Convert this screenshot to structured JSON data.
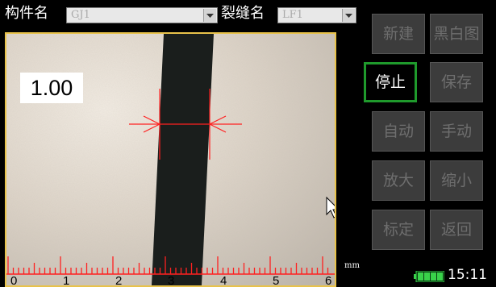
{
  "header": {
    "component_label": "构件名",
    "component_value": "GJ1",
    "crack_label": "裂缝名",
    "crack_value": "LF1"
  },
  "viewer": {
    "measurement_value": "1.00",
    "scale_ticks": [
      "0",
      "1",
      "2",
      "3",
      "4",
      "5",
      "6"
    ],
    "unit": "mm"
  },
  "buttons": [
    {
      "label": "新建",
      "active": false
    },
    {
      "label": "黑白图",
      "active": false
    },
    {
      "label": "停止",
      "active": true
    },
    {
      "label": "保存",
      "active": false
    },
    {
      "label": "自动",
      "active": false
    },
    {
      "label": "手动",
      "active": false
    },
    {
      "label": "放大",
      "active": false
    },
    {
      "label": "缩小",
      "active": false
    },
    {
      "label": "标定",
      "active": false
    },
    {
      "label": "返回",
      "active": false
    }
  ],
  "status": {
    "time": "15:11",
    "battery_level": 1.0
  },
  "colors": {
    "measure_line": "#ff2020",
    "viewport_border": "#e8c24a",
    "active_button_border": "#1f9a2c",
    "battery": "#39d24a"
  }
}
